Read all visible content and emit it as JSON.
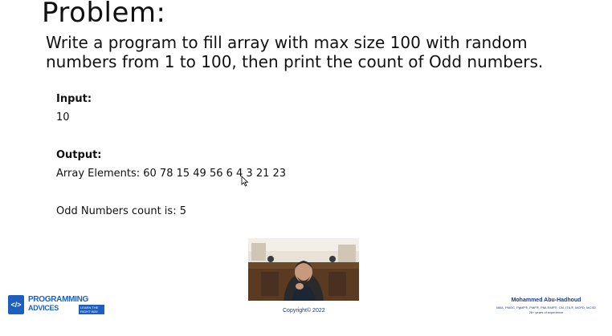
{
  "slide": {
    "title": "Problem:",
    "problem_line1": "Write a program to fill array with max size 100 with random",
    "problem_line2": "numbers from 1 to 100, then print the count of Odd numbers."
  },
  "input": {
    "label": "Input:",
    "value": "10"
  },
  "output": {
    "label": "Output:",
    "array_line": "Array Elements: 60 78 15 49 56 6 4 3 21 23",
    "count_line": "Odd Numbers count is: 5"
  },
  "footer": {
    "copyright": "Copyright© 2022",
    "logo_line1": "PROGRAMMING",
    "logo_line2": "ADVICES",
    "logo_tag": "LEARN THE RIGHT WAY",
    "logo_mark": "</>",
    "author_name": "Mohammed Abu-Hadhoud",
    "author_certs": "MBA, PMOC, PgMP®, PMP®, PMI-RMP®, CM, ITIL®, MCPD, MCSD",
    "author_experience": "26+ years of experience"
  },
  "colors": {
    "brand_blue": "#1d5fbf",
    "footer_text": "#1b3a8a"
  }
}
